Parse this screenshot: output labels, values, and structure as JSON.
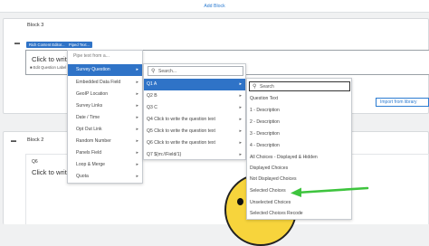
{
  "header": {
    "add_block_label": "Add Block"
  },
  "block3": {
    "title": "Block 3",
    "toolbar": {
      "rich_content": "Rich Content Editor...",
      "piped_text": "Piped Text..."
    },
    "question_text": "Click to write",
    "edit_label": "Edit Question Label"
  },
  "block2": {
    "title": "Block 2",
    "question_id": "Q6",
    "question_text": "Click to write"
  },
  "import_button": "Import from library",
  "menu1": {
    "header": "Pipe text from a...",
    "items": [
      {
        "label": "Survey Question"
      },
      {
        "label": "Embedded Data Field"
      },
      {
        "label": "GeoIP Location"
      },
      {
        "label": "Survey Links"
      },
      {
        "label": "Date / Time"
      },
      {
        "label": "Opt Out Link"
      },
      {
        "label": "Random Number"
      },
      {
        "label": "Panels Field"
      },
      {
        "label": "Loop & Merge"
      },
      {
        "label": "Quota"
      }
    ]
  },
  "menu2": {
    "search_placeholder": "Search...",
    "items": [
      {
        "label": "Q1 A"
      },
      {
        "label": "Q2 B"
      },
      {
        "label": "Q3 C"
      },
      {
        "label": "Q4 Click to write the question text"
      },
      {
        "label": "Q5 Click to write the question text"
      },
      {
        "label": "Q6 Click to write the question text"
      },
      {
        "label": "Q7 ${m://Field/1}"
      }
    ]
  },
  "menu3": {
    "search_placeholder": "Search",
    "items": [
      {
        "label": "Question Text"
      },
      {
        "label": "1 - Description"
      },
      {
        "label": "2 - Description"
      },
      {
        "label": "3 - Description"
      },
      {
        "label": "4 - Description"
      },
      {
        "label": "All Choices - Displayed & Hidden"
      },
      {
        "label": "Displayed Choices"
      },
      {
        "label": "Not Displayed Choices"
      },
      {
        "label": "Selected Choices"
      },
      {
        "label": "Unselected Choices"
      },
      {
        "label": "Selected Choices Recode"
      }
    ]
  },
  "colors": {
    "accent": "#2f73c7",
    "arrow": "#3ec43e",
    "emoji": "#f7d43c"
  }
}
